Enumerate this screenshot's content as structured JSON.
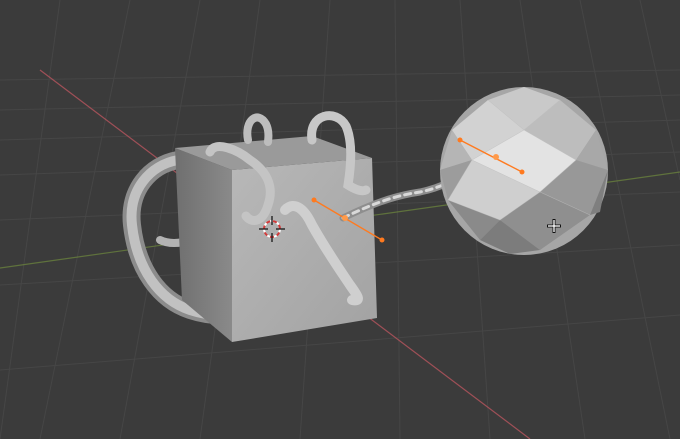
{
  "app": {
    "name": "",
    "view": "3D Viewport"
  },
  "colors": {
    "background": "#3b3b3b",
    "grid_line": "#454545",
    "axis_x": "#b8555e",
    "axis_y": "#6f8a3d",
    "mesh_light": "#c9c9c9",
    "mesh_mid": "#a9a9a9",
    "mesh_dark": "#7d7d7d",
    "selection": "#ff7a1f",
    "cursor": "#ffffff"
  },
  "scene": {
    "objects": [
      {
        "kind": "cube",
        "label": ""
      },
      {
        "kind": "icosphere",
        "label": ""
      },
      {
        "kind": "curve_tubes",
        "label": ""
      },
      {
        "kind": "curve_cable",
        "label": ""
      }
    ],
    "icons": {
      "origin": "3d-cursor-icon",
      "pointer": "crosshair-cursor-icon"
    }
  }
}
